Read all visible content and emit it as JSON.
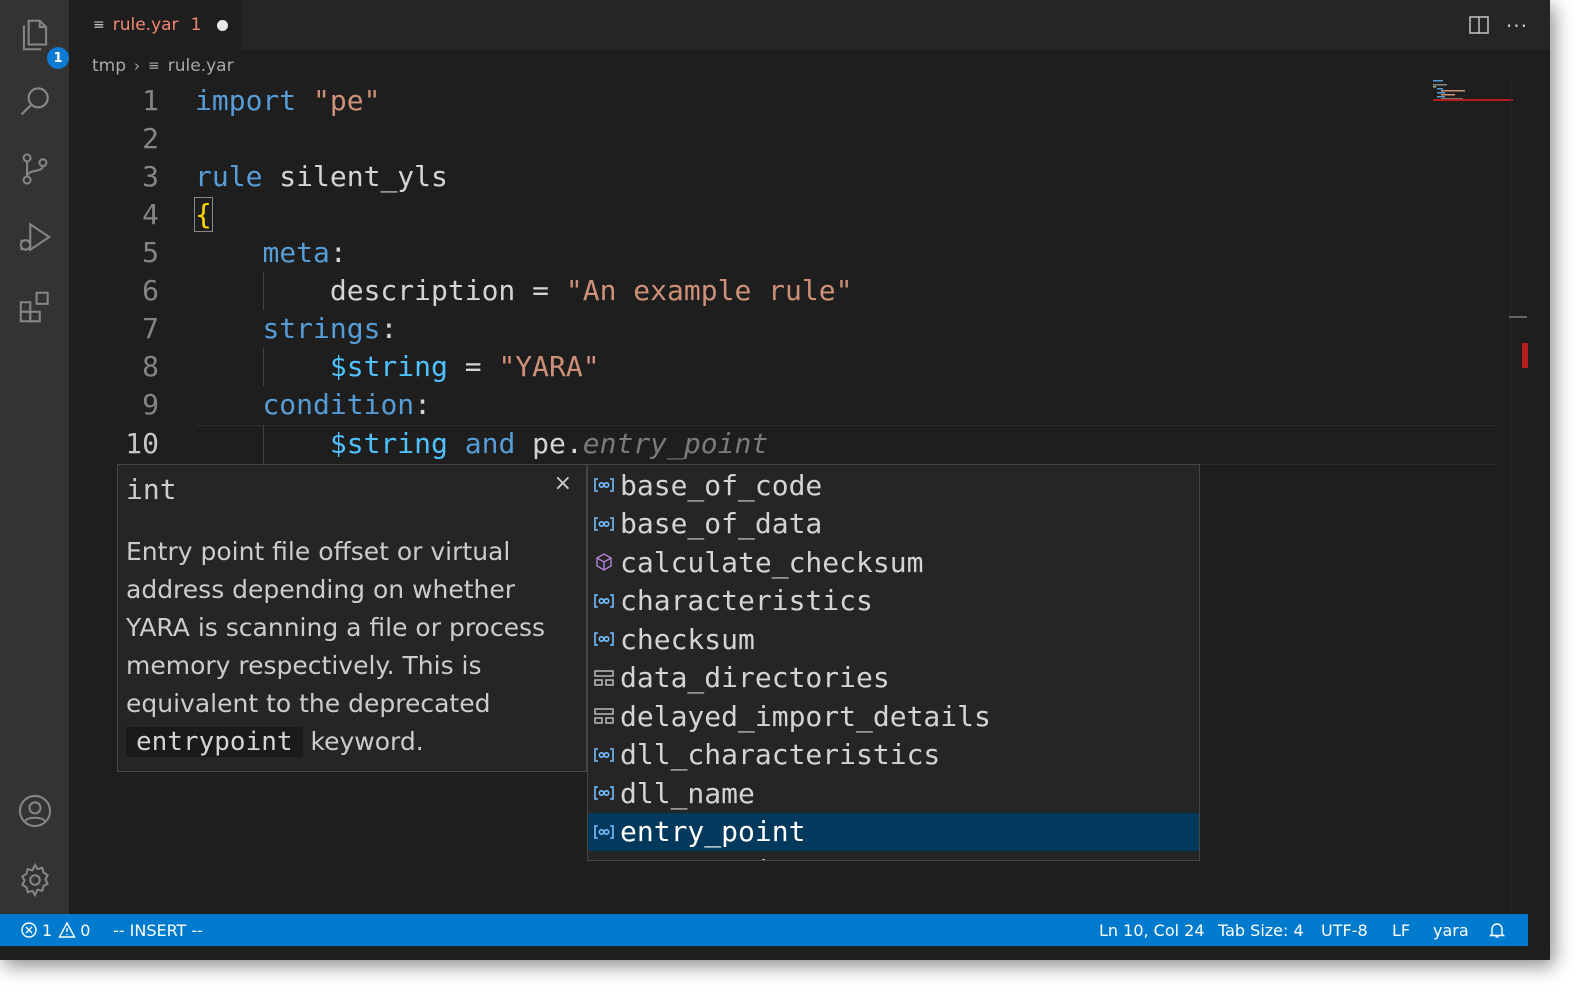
{
  "activity_bar": {
    "explorer_badge": "1",
    "items": [
      "files-icon",
      "search-icon",
      "source-control-icon",
      "run-debug-icon",
      "extensions-icon"
    ],
    "bottom": [
      "account-icon",
      "gear-icon"
    ]
  },
  "tab": {
    "name": "rule.yar",
    "problem_count": "1"
  },
  "breadcrumb": {
    "folder": "tmp",
    "file": "rule.yar"
  },
  "editor": {
    "line_numbers": [
      "1",
      "2",
      "3",
      "4",
      "5",
      "6",
      "7",
      "8",
      "9",
      "10"
    ],
    "lines": {
      "l1_kw": "import",
      "l1_str": "\"pe\"",
      "l3_kw": "rule",
      "l3_name": "silent_yls",
      "l4_brace": "{",
      "l5_kw": "meta",
      "l5_colon": ":",
      "l6_key": "description",
      "l6_eq": "=",
      "l6_str": "\"An example rule\"",
      "l7_kw": "strings",
      "l7_colon": ":",
      "l8_var": "$string",
      "l8_eq": "=",
      "l8_str": "\"YARA\"",
      "l9_kw": "condition",
      "l9_colon": ":",
      "l10_var": "$string",
      "l10_and": "and",
      "l10_mod": "pe.",
      "l10_ghost": "entry_point"
    }
  },
  "details": {
    "type": "int",
    "close": "×",
    "doc_text": "Entry point file offset or virtual address depending on whether YARA is scanning a file or process memory respectively. This is equivalent to the deprecated",
    "doc_code": "entrypoint",
    "doc_tail": "keyword."
  },
  "suggestions": [
    {
      "label": "base_of_code",
      "icon": "field-icon"
    },
    {
      "label": "base_of_data",
      "icon": "field-icon"
    },
    {
      "label": "calculate_checksum",
      "icon": "method-icon"
    },
    {
      "label": "characteristics",
      "icon": "field-icon"
    },
    {
      "label": "checksum",
      "icon": "field-icon"
    },
    {
      "label": "data_directories",
      "icon": "struct-icon"
    },
    {
      "label": "delayed_import_details",
      "icon": "struct-icon"
    },
    {
      "label": "dll_characteristics",
      "icon": "field-icon"
    },
    {
      "label": "dll_name",
      "icon": "field-icon"
    },
    {
      "label": "entry_point",
      "icon": "field-icon",
      "selected": true
    },
    {
      "label": "entry_point_raw",
      "icon": "field-icon"
    }
  ],
  "status": {
    "errors": "1",
    "warnings": "0",
    "mode": "-- INSERT --",
    "position": "Ln 10, Col 24",
    "tab_size": "Tab Size: 4",
    "encoding": "UTF-8",
    "eol": "LF",
    "language": "yara"
  },
  "colors": {
    "status_bar": "#007acc",
    "selection": "#04395e",
    "keyword": "#569cd6",
    "string": "#ce9178",
    "variable": "#4fc1ff",
    "error": "#f48771"
  }
}
